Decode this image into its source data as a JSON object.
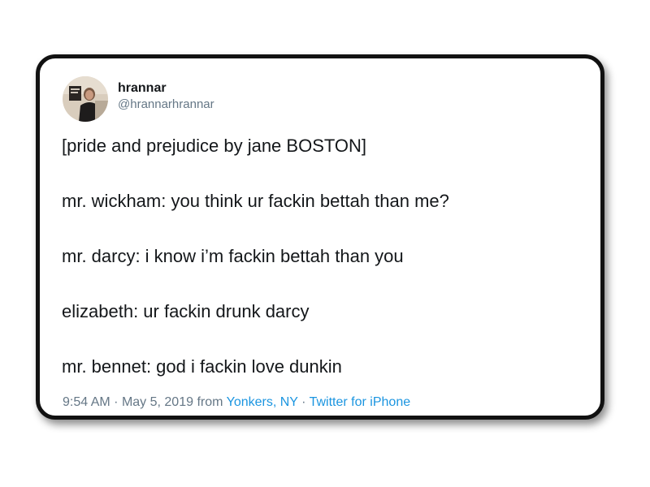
{
  "tweet": {
    "display_name": "hrannar",
    "handle": "@hrannarhrannar",
    "lines": [
      "[pride and prejudice by jane BOSTON]",
      "mr. wickham: you think ur fackin bettah than me?",
      "mr. darcy: i know i’m fackin bettah than you",
      "elizabeth: ur fackin drunk darcy",
      "mr. bennet: god i fackin love dunkin"
    ],
    "time": "9:54 AM",
    "date": "May 5, 2019",
    "from_label": "from",
    "location": "Yonkers, NY",
    "source": "Twitter for iPhone",
    "separator": "·"
  },
  "colors": {
    "text": "#14171a",
    "secondary": "#657786",
    "link": "#1b95e0",
    "card_border": "#111111"
  },
  "icons": {
    "avatar": "profile-photo"
  }
}
